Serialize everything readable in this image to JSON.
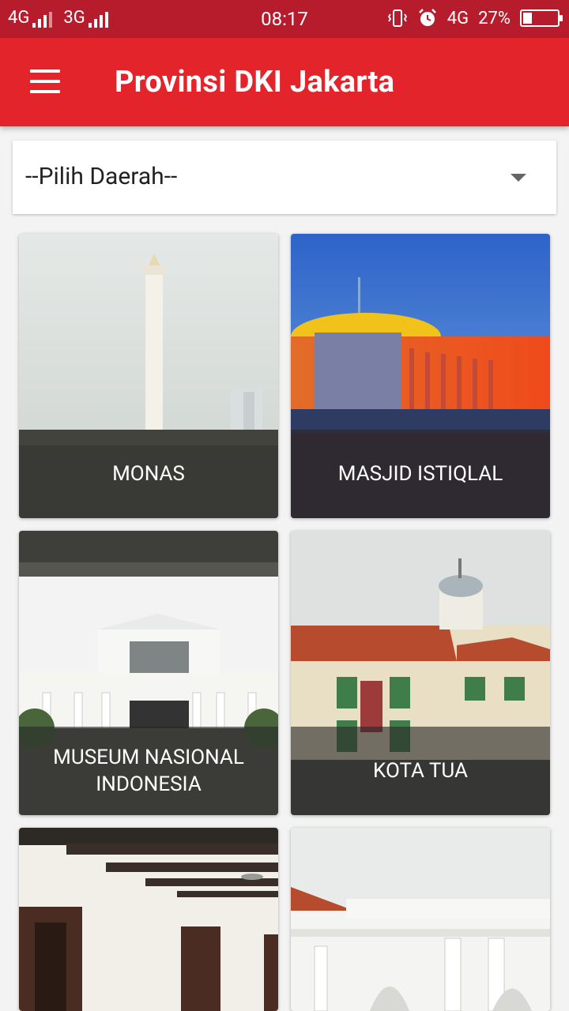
{
  "statusbar": {
    "net1": "4G",
    "net2": "3G",
    "time": "08:17",
    "net3": "4G",
    "battery": "27%",
    "battery_level": 0.27
  },
  "appbar": {
    "title": "Provinsi DKI Jakarta",
    "menu_icon": "hamburger-menu-icon"
  },
  "spinner": {
    "selected": "--Pilih Daerah--"
  },
  "places": [
    {
      "name": "MONAS"
    },
    {
      "name": "MASJID ISTIQLAL"
    },
    {
      "name": "MUSEUM NASIONAL INDONESIA"
    },
    {
      "name": "KOTA TUA"
    },
    {
      "name": ""
    },
    {
      "name": ""
    }
  ]
}
